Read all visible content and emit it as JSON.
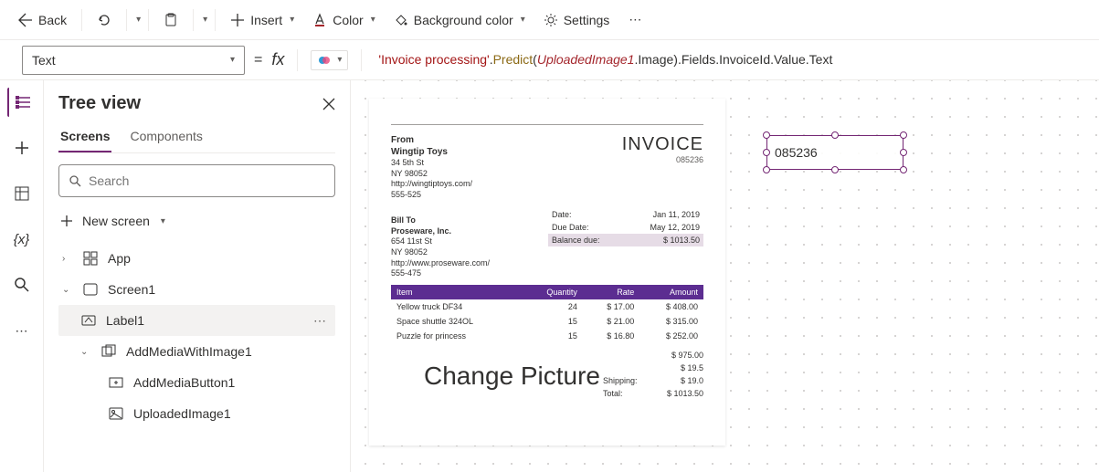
{
  "toolbar": {
    "back": "Back",
    "insert": "Insert",
    "color": "Color",
    "bgcolor": "Background color",
    "settings": "Settings"
  },
  "formula": {
    "property": "Text",
    "expression_parts": {
      "str": "'Invoice processing'",
      "dot1": ".",
      "fn": "Predict",
      "open": "(",
      "arg": "UploadedImage1",
      "dotimg": ".Image",
      "close": ")",
      "tail": ".Fields.InvoiceId.Value.Text"
    }
  },
  "tree": {
    "title": "Tree view",
    "tabs": {
      "screens": "Screens",
      "components": "Components"
    },
    "search_placeholder": "Search",
    "new_screen": "New screen",
    "items": [
      {
        "label": "App"
      },
      {
        "label": "Screen1"
      },
      {
        "label": "Label1"
      },
      {
        "label": "AddMediaWithImage1"
      },
      {
        "label": "AddMediaButton1"
      },
      {
        "label": "UploadedImage1"
      }
    ]
  },
  "invoice": {
    "from_label": "From",
    "from_name": "Wingtip Toys",
    "from_addr1": "34 5th St",
    "from_addr2": "NY 98052",
    "from_url": "http://wingtiptoys.com/",
    "from_phone": "555-525",
    "title": "INVOICE",
    "number": "085236",
    "meta": {
      "date_label": "Date:",
      "date_value": "Jan 11, 2019",
      "due_label": "Due Date:",
      "due_value": "May 12, 2019",
      "balance_label": "Balance due:",
      "balance_value": "$ 1013.50"
    },
    "billto_label": "Bill To",
    "billto_name": "Proseware, Inc.",
    "billto_addr1": "654 11st St",
    "billto_addr2": "NY 98052",
    "billto_url": "http://www.proseware.com/",
    "billto_phone": "555-475",
    "cols": {
      "item": "Item",
      "qty": "Quantity",
      "rate": "Rate",
      "amount": "Amount"
    },
    "rows": [
      {
        "item": "Yellow truck DF34",
        "qty": "24",
        "rate": "$ 17.00",
        "amount": "$ 408.00"
      },
      {
        "item": "Space shuttle 324OL",
        "qty": "15",
        "rate": "$ 21.00",
        "amount": "$ 315.00"
      },
      {
        "item": "Puzzle for princess",
        "qty": "15",
        "rate": "$ 16.80",
        "amount": "$ 252.00"
      }
    ],
    "change_picture": "Change Picture",
    "totals": [
      {
        "label": "",
        "value": "$ 975.00"
      },
      {
        "label": "",
        "value": "$ 19.5"
      },
      {
        "label": "Shipping:",
        "value": "$ 19.0"
      },
      {
        "label": "Total:",
        "value": "$ 1013.50"
      }
    ]
  },
  "selected_output": "085236"
}
